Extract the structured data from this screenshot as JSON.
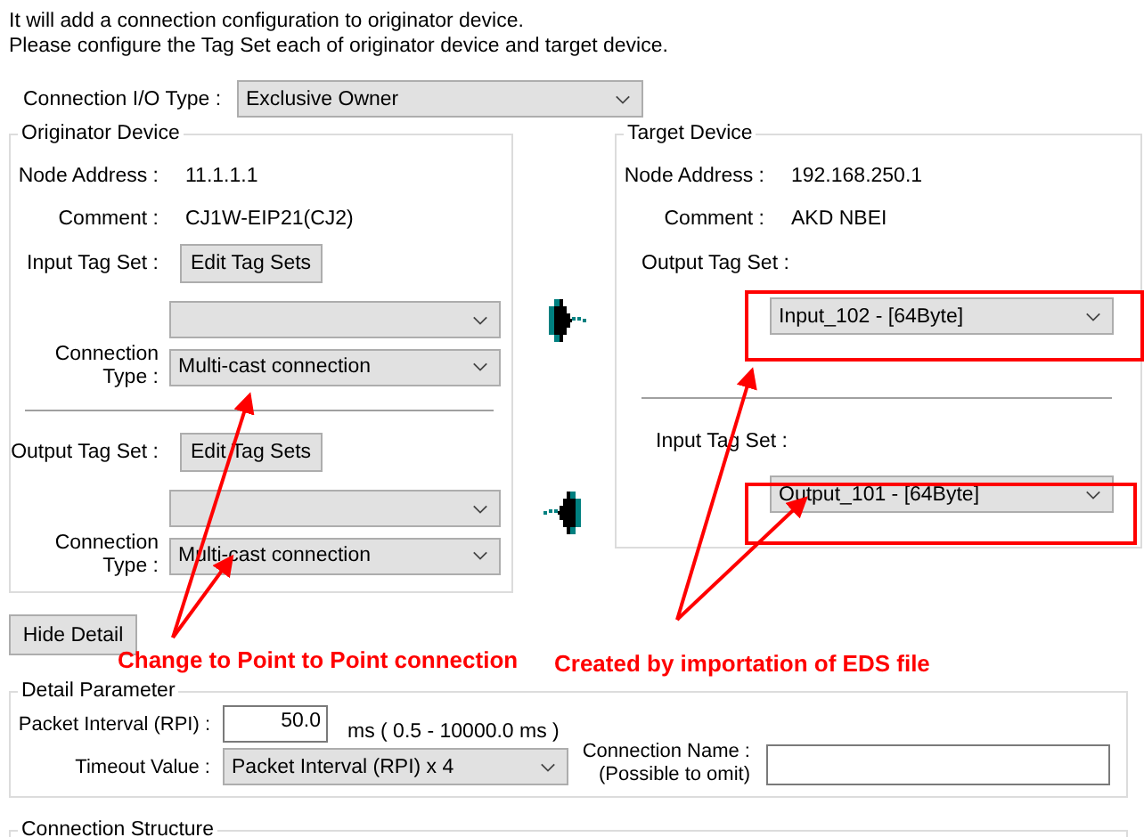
{
  "intro": [
    "It will add a connection configuration to originator device.",
    "Please configure the Tag Set each of originator device and target device."
  ],
  "io_type": {
    "label": "Connection I/O Type :",
    "value": "Exclusive Owner"
  },
  "originator": {
    "title": "Originator Device",
    "node_label": "Node Address :",
    "node": "11.1.1.1",
    "comment_label": "Comment :",
    "comment": "CJ1W-EIP21(CJ2)",
    "sections": [
      {
        "label": "Input Tag Set :",
        "button": "Edit Tag Sets",
        "type_label_1": "Connection",
        "type_label_2": "Type :",
        "connection_type": "Multi-cast connection"
      },
      {
        "label": "Output Tag Set :",
        "button": "Edit Tag Sets",
        "type_label_1": "Connection",
        "type_label_2": "Type :",
        "connection_type": "Multi-cast connection"
      }
    ]
  },
  "target": {
    "title": "Target Device",
    "node_label": "Node Address :",
    "node": "192.168.250.1",
    "comment_label": "Comment :",
    "comment": "AKD NBEI",
    "sections": [
      {
        "label": "Output Tag Set :",
        "value": "Input_102 - [64Byte]"
      },
      {
        "label": "Input Tag Set :",
        "value": "Output_101 - [64Byte]"
      }
    ]
  },
  "hide_detail": "Hide Detail",
  "detail": {
    "title": "Detail Parameter",
    "rpi_label": "Packet Interval (RPI) :",
    "rpi": "50.0",
    "rpi_range": "ms ( 0.5 - 10000.0 ms )",
    "timeout_label": "Timeout Value :",
    "timeout": "Packet Interval (RPI) x 4",
    "name_label_1": "Connection Name :",
    "name_label_2": "(Possible to omit)"
  },
  "structure": {
    "title": "Connection Structure"
  },
  "annotations": [
    {
      "text": "Change to Point to Point connection"
    },
    {
      "text": "Created by importation of EDS file"
    }
  ]
}
